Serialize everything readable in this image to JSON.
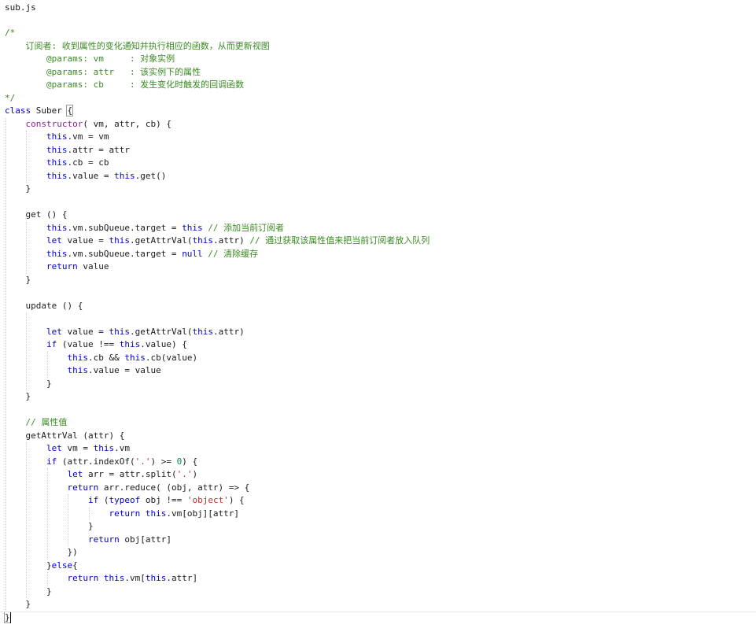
{
  "file": {
    "name": "sub.js"
  },
  "code_lines": [
    [
      [
        "cm",
        "/*"
      ]
    ],
    [
      [
        "cm",
        "    订阅者: 收到属性的变化通知并执行相应的函数，从而更新视图"
      ]
    ],
    [
      [
        "cm",
        "        @params: vm     : 对象实例"
      ]
    ],
    [
      [
        "cm",
        "        @params: attr   : 该实例下的属性"
      ]
    ],
    [
      [
        "cm",
        "        @params: cb     : 发生变化时触发的回调函数"
      ]
    ],
    [
      [
        "cm",
        "*/"
      ]
    ],
    [
      [
        "kw",
        "class"
      ],
      [
        "pl",
        " Suber "
      ],
      [
        "pl",
        "{"
      ]
    ],
    [
      [
        "pl",
        "    "
      ],
      [
        "fn",
        "constructor"
      ],
      [
        "pl",
        "( vm, attr, cb) {"
      ]
    ],
    [
      [
        "pl",
        "        "
      ],
      [
        "kw",
        "this"
      ],
      [
        "pl",
        ".vm = vm"
      ]
    ],
    [
      [
        "pl",
        "        "
      ],
      [
        "kw",
        "this"
      ],
      [
        "pl",
        ".attr = attr"
      ]
    ],
    [
      [
        "pl",
        "        "
      ],
      [
        "kw",
        "this"
      ],
      [
        "pl",
        ".cb = cb"
      ]
    ],
    [
      [
        "pl",
        "        "
      ],
      [
        "kw",
        "this"
      ],
      [
        "pl",
        ".value = "
      ],
      [
        "kw",
        "this"
      ],
      [
        "pl",
        ".get()"
      ]
    ],
    [
      [
        "pl",
        "    }"
      ]
    ],
    [
      [
        "pl",
        ""
      ]
    ],
    [
      [
        "pl",
        "    get () {"
      ]
    ],
    [
      [
        "pl",
        "        "
      ],
      [
        "kw",
        "this"
      ],
      [
        "pl",
        ".vm.subQueue.target = "
      ],
      [
        "kw",
        "this"
      ],
      [
        "cm",
        " // 添加当前订阅者"
      ]
    ],
    [
      [
        "pl",
        "        "
      ],
      [
        "kw",
        "let"
      ],
      [
        "pl",
        " value = "
      ],
      [
        "kw",
        "this"
      ],
      [
        "pl",
        ".getAttrVal("
      ],
      [
        "kw",
        "this"
      ],
      [
        "pl",
        ".attr)"
      ],
      [
        "cm",
        " // 通过获取该属性值来把当前订阅者放入队列"
      ]
    ],
    [
      [
        "pl",
        "        "
      ],
      [
        "kw",
        "this"
      ],
      [
        "pl",
        ".vm.subQueue.target = "
      ],
      [
        "kw",
        "null"
      ],
      [
        "cm",
        " // 清除缓存"
      ]
    ],
    [
      [
        "pl",
        "        "
      ],
      [
        "kw",
        "return"
      ],
      [
        "pl",
        " value"
      ]
    ],
    [
      [
        "pl",
        "    }"
      ]
    ],
    [
      [
        "pl",
        ""
      ]
    ],
    [
      [
        "pl",
        "    update () {"
      ]
    ],
    [
      [
        "pl",
        ""
      ]
    ],
    [
      [
        "pl",
        "        "
      ],
      [
        "kw",
        "let"
      ],
      [
        "pl",
        " value = "
      ],
      [
        "kw",
        "this"
      ],
      [
        "pl",
        ".getAttrVal("
      ],
      [
        "kw",
        "this"
      ],
      [
        "pl",
        ".attr)"
      ]
    ],
    [
      [
        "pl",
        "        "
      ],
      [
        "kw",
        "if"
      ],
      [
        "pl",
        " (value !== "
      ],
      [
        "kw",
        "this"
      ],
      [
        "pl",
        ".value) {"
      ]
    ],
    [
      [
        "pl",
        "            "
      ],
      [
        "kw",
        "this"
      ],
      [
        "pl",
        ".cb && "
      ],
      [
        "kw",
        "this"
      ],
      [
        "pl",
        ".cb(value)"
      ]
    ],
    [
      [
        "pl",
        "            "
      ],
      [
        "kw",
        "this"
      ],
      [
        "pl",
        ".value = value"
      ]
    ],
    [
      [
        "pl",
        "        }"
      ]
    ],
    [
      [
        "pl",
        "    }"
      ]
    ],
    [
      [
        "pl",
        ""
      ]
    ],
    [
      [
        "pl",
        "    "
      ],
      [
        "cm",
        "// 属性值"
      ]
    ],
    [
      [
        "pl",
        "    getAttrVal (attr) {"
      ]
    ],
    [
      [
        "pl",
        "        "
      ],
      [
        "kw",
        "let"
      ],
      [
        "pl",
        " vm = "
      ],
      [
        "kw",
        "this"
      ],
      [
        "pl",
        ".vm"
      ]
    ],
    [
      [
        "pl",
        "        "
      ],
      [
        "kw",
        "if"
      ],
      [
        "pl",
        " (attr.indexOf("
      ],
      [
        "str",
        "'.'"
      ],
      [
        "pl",
        ") >= "
      ],
      [
        "num",
        "0"
      ],
      [
        "pl",
        ") {"
      ]
    ],
    [
      [
        "pl",
        "            "
      ],
      [
        "kw",
        "let"
      ],
      [
        "pl",
        " arr = attr.split("
      ],
      [
        "str",
        "'.'"
      ],
      [
        "pl",
        ")"
      ]
    ],
    [
      [
        "pl",
        "            "
      ],
      [
        "kw",
        "return"
      ],
      [
        "pl",
        " arr.reduce( (obj, attr) => {"
      ]
    ],
    [
      [
        "pl",
        "                "
      ],
      [
        "kw",
        "if"
      ],
      [
        "pl",
        " ("
      ],
      [
        "kw",
        "typeof"
      ],
      [
        "pl",
        " obj !== "
      ],
      [
        "str",
        "'object'"
      ],
      [
        "pl",
        ") {"
      ]
    ],
    [
      [
        "pl",
        "                    "
      ],
      [
        "kw",
        "return"
      ],
      [
        "pl",
        " "
      ],
      [
        "kw",
        "this"
      ],
      [
        "pl",
        ".vm[obj][attr]"
      ]
    ],
    [
      [
        "pl",
        "                }"
      ]
    ],
    [
      [
        "pl",
        "                "
      ],
      [
        "kw",
        "return"
      ],
      [
        "pl",
        " obj[attr]"
      ]
    ],
    [
      [
        "pl",
        "            })"
      ]
    ],
    [
      [
        "pl",
        "        }"
      ],
      [
        "kw",
        "else"
      ],
      [
        "pl",
        "{"
      ]
    ],
    [
      [
        "pl",
        "            "
      ],
      [
        "kw",
        "return"
      ],
      [
        "pl",
        " "
      ],
      [
        "kw",
        "this"
      ],
      [
        "pl",
        ".vm["
      ],
      [
        "kw",
        "this"
      ],
      [
        "pl",
        ".attr]"
      ]
    ],
    [
      [
        "pl",
        "        }"
      ]
    ],
    [
      [
        "pl",
        "    }"
      ]
    ],
    [
      [
        "pl",
        "}"
      ]
    ]
  ],
  "colors": {
    "keyword": "#0000d0",
    "comment": "#3a8a22",
    "string": "#b5342f",
    "number": "#098658",
    "function": "#8a1d8a",
    "plain": "#1a1a1a",
    "background": "#ffffff"
  }
}
